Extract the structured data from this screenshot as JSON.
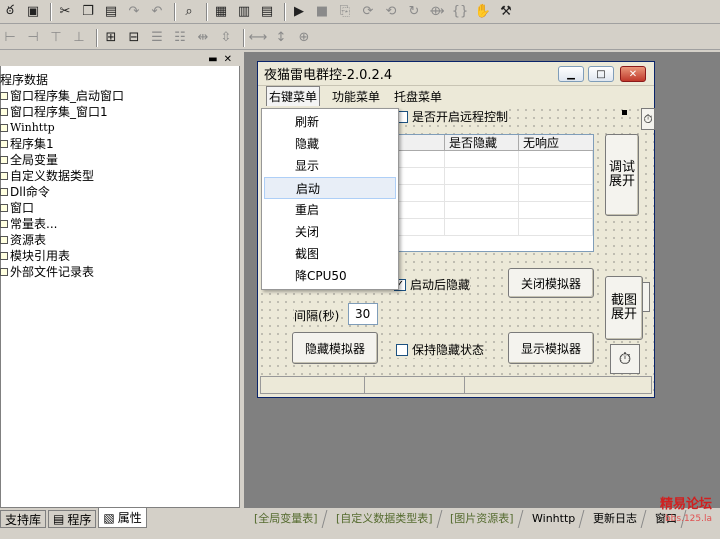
{
  "tree": {
    "items": [
      {
        "label": "程序数据",
        "indent": 0
      },
      {
        "label": "窗口程序集_启动窗口",
        "indent": 1
      },
      {
        "label": "窗口程序集_窗口1",
        "indent": 1
      },
      {
        "label": "Winhttp",
        "indent": 1
      },
      {
        "label": "程序集1",
        "indent": 1
      },
      {
        "label": "全局变量",
        "indent": 1
      },
      {
        "label": "自定义数据类型",
        "indent": 1
      },
      {
        "label": "Dll命令",
        "indent": 1
      },
      {
        "label": "窗口",
        "indent": 1
      },
      {
        "label": "常量表...",
        "indent": 1
      },
      {
        "label": "资源表",
        "indent": 1
      },
      {
        "label": "模块引用表",
        "indent": 1
      },
      {
        "label": "外部文件记录表",
        "indent": 1
      }
    ]
  },
  "left_tabs": [
    {
      "label": "支持库"
    },
    {
      "label": "程序"
    },
    {
      "label": "属性"
    }
  ],
  "window": {
    "title": "夜猫雷电群控-2.0.2.4"
  },
  "menubar": [
    "右键菜单",
    "功能菜单",
    "托盘菜单"
  ],
  "context_menu": [
    "刷新",
    "隐藏",
    "显示",
    "启动",
    "重启",
    "关闭",
    "截图",
    "降CPU50"
  ],
  "context_menu_highlight": 3,
  "controls": {
    "remote_checkbox": "是否开启远程控制",
    "grid_headers": [
      "是否隐藏",
      "无响应"
    ],
    "debug_button": "调试\n展开",
    "screenshot_button": "截图\n展开",
    "auto_hide_checkbox": "启动后隐藏",
    "close_emulator": "关闭模拟器",
    "interval_label": "间隔(秒)",
    "interval_value": "30",
    "hide_emulator": "隐藏模拟器",
    "keep_hidden_checkbox": "保持隐藏状态",
    "show_emulator": "显示模拟器"
  },
  "right_tabs": [
    "[全局变量表]",
    "[自定义数据类型表]",
    "[图片资源表]",
    "Winhttp",
    "更新日志",
    "窗口"
  ],
  "watermark": {
    "main": "精易论坛",
    "sub": "bbs.125.la"
  }
}
